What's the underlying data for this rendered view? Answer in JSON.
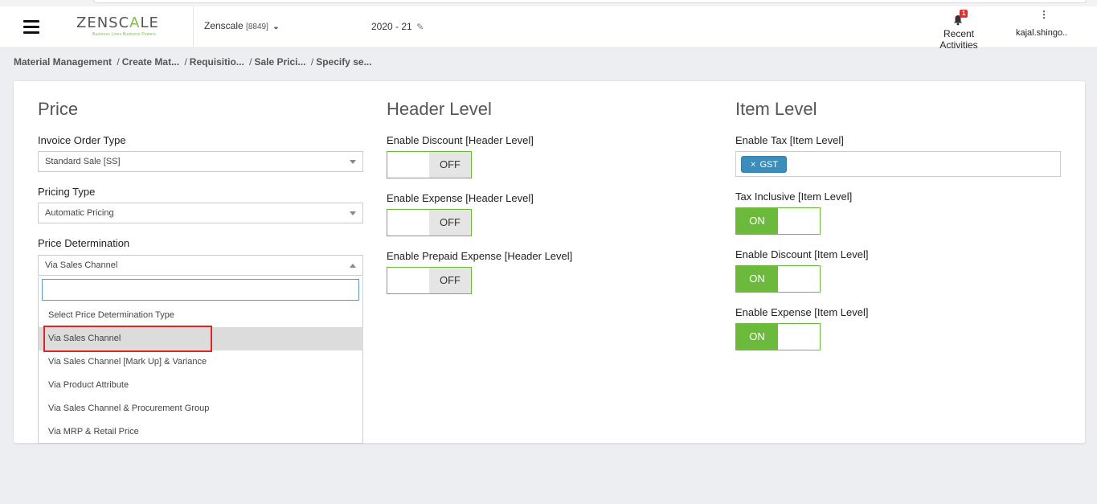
{
  "header": {
    "logo_text_a": "ZENSC",
    "logo_text_b": "A",
    "logo_text_c": "LE",
    "logo_tagline": "Business Lives Business Powers",
    "company_name": "Zenscale",
    "company_code": "[8849]",
    "financial_year": "2020 - 21",
    "activities_label": "Recent Activities",
    "activities_badge": "1",
    "user_name": "kajal.shingo.."
  },
  "breadcrumb": [
    "Material Management",
    "Create Mat...",
    "Requisitio...",
    "Sale Prici...",
    "Specify se..."
  ],
  "price": {
    "title": "Price",
    "invoice_order_type_label": "Invoice Order Type",
    "invoice_order_type_value": "Standard Sale [SS]",
    "pricing_type_label": "Pricing Type",
    "pricing_type_value": "Automatic Pricing",
    "price_determination_label": "Price Determination",
    "price_determination_value": "Via Sales Channel",
    "search_placeholder": "",
    "options": [
      "Select Price Determination Type",
      "Via Sales Channel",
      "Via Sales Channel [Mark Up] & Variance",
      "Via Product Attribute",
      "Via Sales Channel & Procurement Group",
      "Via MRP & Retail Price"
    ],
    "selected_option": "Via Sales Channel"
  },
  "header_level": {
    "title": "Header Level",
    "enable_discount_label": "Enable Discount [Header Level]",
    "enable_discount_state": "OFF",
    "enable_expense_label": "Enable Expense [Header Level]",
    "enable_expense_state": "OFF",
    "enable_prepaid_label": "Enable Prepaid Expense [Header Level]",
    "enable_prepaid_state": "OFF"
  },
  "item_level": {
    "title": "Item Level",
    "enable_tax_label": "Enable Tax [Item Level]",
    "tax_tags": [
      "GST"
    ],
    "tax_inclusive_label": "Tax Inclusive [Item Level]",
    "tax_inclusive_state": "ON",
    "enable_discount_label": "Enable Discount [Item Level]",
    "enable_discount_state": "ON",
    "enable_expense_label": "Enable Expense [Item Level]",
    "enable_expense_state": "ON"
  },
  "colors": {
    "toggle_on": "#6cba3c",
    "tag_bg": "#3c8dbc",
    "highlight": "#e02424",
    "logo_accent": "#7cc242"
  }
}
